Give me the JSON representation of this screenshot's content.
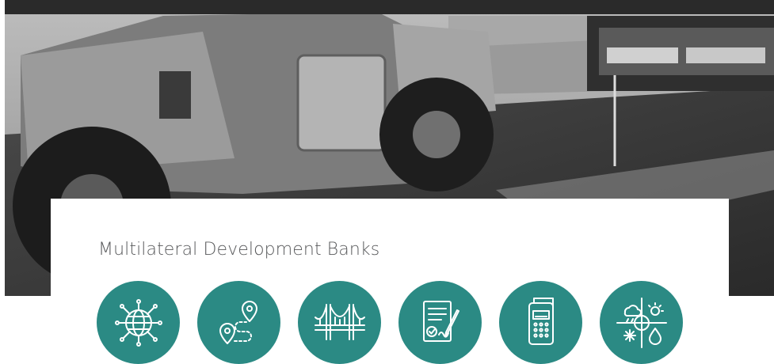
{
  "section": {
    "title": "Multilateral Development Banks"
  },
  "hero": {
    "image": "grayscale-road-roller-asphalt-paving-photo"
  },
  "icons": [
    {
      "name": "globe-network-icon"
    },
    {
      "name": "route-map-pins-icon"
    },
    {
      "name": "suspension-bridge-icon"
    },
    {
      "name": "signed-document-icon"
    },
    {
      "name": "payment-terminal-icon"
    },
    {
      "name": "climate-weather-icon"
    }
  ],
  "colors": {
    "icon_background": "#2b8a84",
    "title_text": "#58595b"
  }
}
